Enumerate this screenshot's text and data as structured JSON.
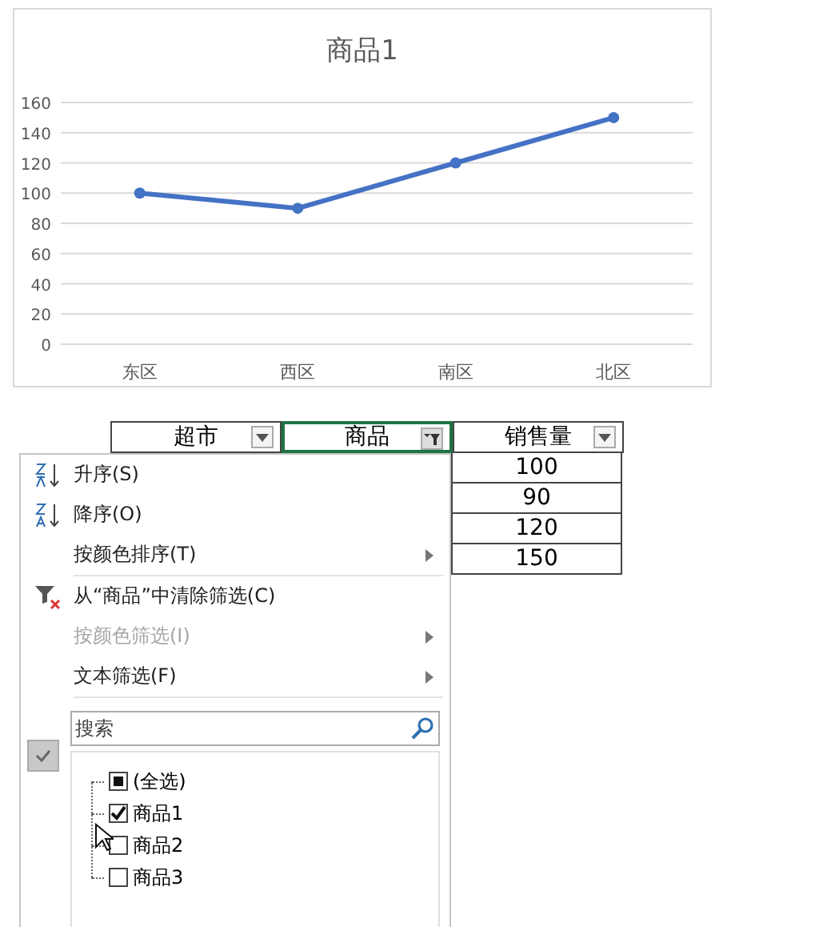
{
  "chart": {
    "chart_data": {
      "type": "line",
      "title": "商品1",
      "categories": [
        "东区",
        "西区",
        "南区",
        "北区"
      ],
      "series": [
        {
          "color": "#4472c4",
          "marker": true,
          "values": [
            100,
            90,
            120,
            150
          ]
        }
      ],
      "grid": true,
      "ylim": [
        0,
        160
      ],
      "yticks": [
        0,
        20,
        40,
        60,
        80,
        100,
        120,
        140,
        160
      ]
    }
  },
  "table": {
    "columns": [
      {
        "label": "超市",
        "filtered": false,
        "selected": false
      },
      {
        "label": "商品",
        "filtered": true,
        "selected": true
      },
      {
        "label": "销售量",
        "filtered": false,
        "selected": false
      }
    ],
    "visible_values": [
      "100",
      "90",
      "120",
      "150"
    ]
  },
  "filter_menu": {
    "items": [
      {
        "kind": "sort-asc",
        "label": "升序(S)",
        "disabled": false
      },
      {
        "kind": "sort-desc",
        "label": "降序(O)",
        "disabled": false
      },
      {
        "kind": "submenu",
        "label": "按颜色排序(T)",
        "disabled": false
      },
      {
        "kind": "separator"
      },
      {
        "kind": "clear-filter",
        "label": "从“商品”中清除筛选(C)",
        "disabled": false
      },
      {
        "kind": "submenu",
        "label": "按颜色筛选(I)",
        "disabled": true
      },
      {
        "kind": "submenu",
        "label": "文本筛选(F)",
        "disabled": false
      },
      {
        "kind": "separator"
      }
    ],
    "search": {
      "placeholder": "搜索"
    },
    "values": [
      {
        "label": "(全选)",
        "checked": false,
        "indeterminate": true
      },
      {
        "label": "商品1",
        "checked": true,
        "indeterminate": false
      },
      {
        "label": "商品2",
        "checked": false,
        "indeterminate": false
      },
      {
        "label": "商品3",
        "checked": false,
        "indeterminate": false
      }
    ]
  }
}
